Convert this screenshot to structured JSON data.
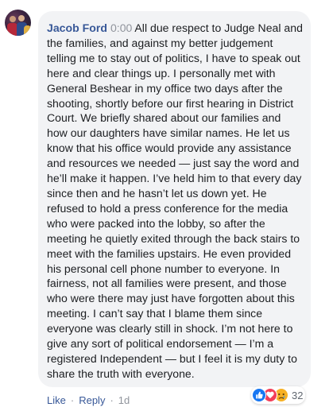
{
  "comment": {
    "author": "Jacob Ford",
    "timestamp": "0:00",
    "text": "All due respect to Judge Neal and the families, and against my better judgement telling me to stay out of politics, I have to speak out here and clear things up. I personally met with General Beshear in my office two days after the shooting, shortly before our first hearing in District Court. We briefly shared about our families and how our daughters have similar names. He let us know that his office would provide any assistance and resources we needed — just say the word and he’ll make it happen. I’ve held him to that every day since then and he hasn’t let us down yet. He refused to hold a press conference for the media who were packed into the lobby, so after the meeting he quietly exited through the back stairs to meet with the families upstairs. He even provided his personal cell phone number to everyone. In fairness, not all families were present, and those who were there may just have forgotten about this meeting. I can’t say that I blame them since everyone was clearly still in shock. I’m not here to give any sort of political endorsement — I’m a registered Independent — but I feel it is my duty to share the truth with everyone."
  },
  "reactions": {
    "icons": [
      "like-icon",
      "love-icon",
      "sad-icon"
    ],
    "count": "32"
  },
  "actions": {
    "like_label": "Like",
    "reply_label": "Reply",
    "separator": "·",
    "time": "1d"
  },
  "colors": {
    "link": "#385898",
    "bubble": "#f2f3f5",
    "muted": "#90949c",
    "like": "#1877f2",
    "love": "#f33e58",
    "sad": "#f7b125"
  }
}
